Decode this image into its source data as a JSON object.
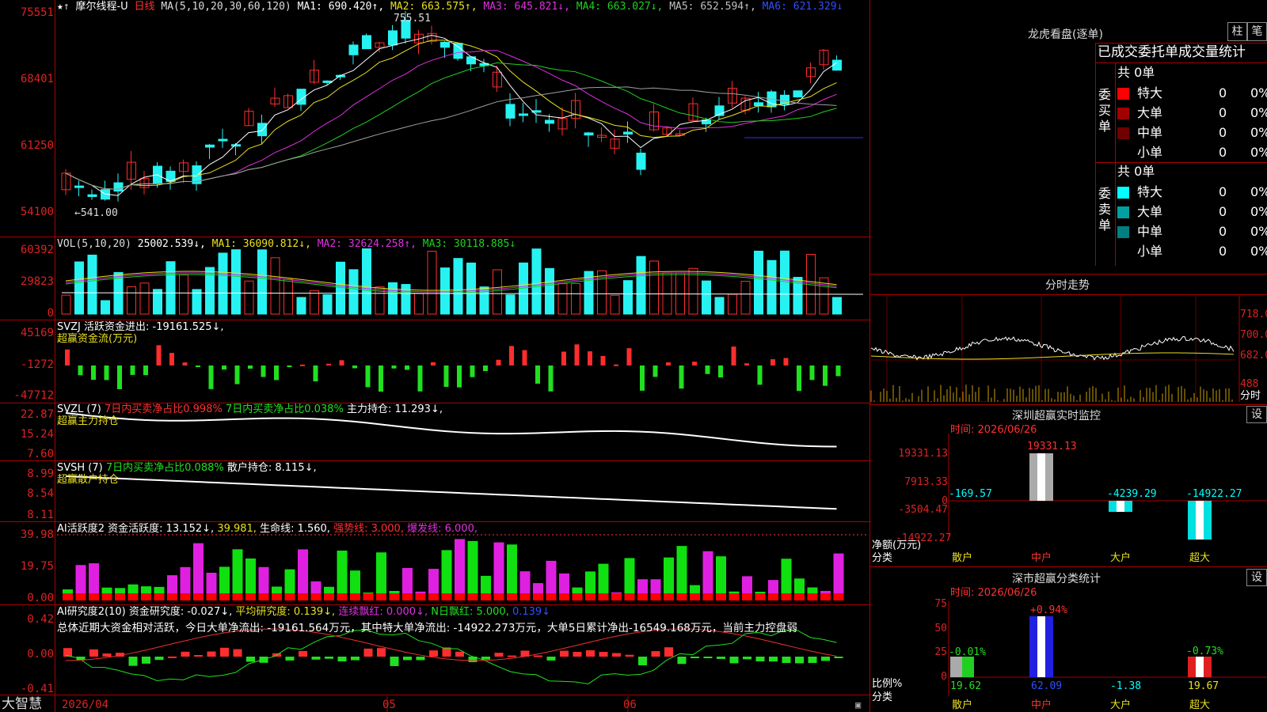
{
  "app": {
    "brand": "大智慧",
    "stock": "摩尔线程-U",
    "period": "日线"
  },
  "colors": {
    "up": "#ff2d2d",
    "down": "#27f2f2",
    "ma1": "#ffffff",
    "ma2": "#e8e020",
    "ma3": "#e030e0",
    "ma4": "#20d020",
    "ma5": "#a0a0a0",
    "ma6": "#3030ff"
  },
  "price_panel": {
    "ma_header": "MA(5,10,20,30,60,120)",
    "ma1": "MA1: 690.420↑,",
    "ma2": "MA2: 663.575↑,",
    "ma3": "MA3: 645.821↓,",
    "ma4": "MA4: 663.027↓,",
    "ma5": "MA5: 652.594↑,",
    "ma6": "MA6: 621.329↓",
    "y_ticks": [
      "75551",
      "68401",
      "61250",
      "54100"
    ],
    "high_label": "755.51",
    "low_label": "←541.00"
  },
  "vol_panel": {
    "header": "VOL(5,10,20)",
    "value": "25002.539↓,",
    "ma1": "MA1: 36090.812↓,",
    "ma2": "MA2: 32624.258↑,",
    "ma3": "MA3: 30118.885↓",
    "y_ticks": [
      "60392",
      "29823",
      "0"
    ]
  },
  "svzj_panel": {
    "header": "SVZJ  活跃资金进出: -19161.525↓,",
    "sub": "超赢资金流(万元)",
    "y_ticks": [
      "45169",
      "-1272",
      "-47712"
    ]
  },
  "svzl_panel": {
    "header": "SVZL (7)",
    "p1": "7日内买卖净占比0.998%",
    "p2": "7日内买卖净占比0.038%",
    "p3": "主力持仓: 11.293↓,",
    "sub": "超赢主力持仓",
    "y_ticks": [
      "22.87",
      "15.24",
      "7.60"
    ]
  },
  "svsh_panel": {
    "header": "SVSH (7)",
    "p1": "7日内买卖净占比0.088%",
    "p2": "散户持仓: 8.115↓,",
    "sub": "超赢散户持仓",
    "y_ticks": [
      "8.99",
      "8.54",
      "8.11"
    ]
  },
  "ai1_panel": {
    "header": "AI活跃度2",
    "p1": "资金活跃度: 13.152↓,",
    "p2": "39.981,",
    "p3": "生命线: 1.560,",
    "p4": "强势线: 3.000,",
    "p5": "爆发线: 6.000,",
    "y_ticks": [
      "39.98",
      "19.75",
      "0.00"
    ]
  },
  "ai2_panel": {
    "header": "AI研究度2(10)",
    "p1": "资金研究度: -0.027↓,",
    "p2": "平均研究度: 0.139↓,",
    "p3": "连续飘红: 0.000↓,",
    "p4": "N日飘红: 5.000,",
    "p5": "0.139↓",
    "comment": "总体近期大资金相对活跃，今日大单净流出: -19161.564万元，其中特大单净流出: -14922.273万元，大单5日累计净出-16549.168万元，当前主力控盘弱",
    "y_ticks": [
      "0.42",
      "0.00",
      "-0.41"
    ]
  },
  "x_axis": {
    "labels": [
      "2026/04",
      "05",
      "06"
    ]
  },
  "lhb": {
    "title": "龙虎看盘(逐单)",
    "btn1": "柱",
    "btn2": "笔",
    "subtitle": "已成交委托单成交量统计",
    "buy_label": "委买单",
    "sell_label": "委卖单",
    "buy": {
      "total": "共 0单",
      "rows": [
        {
          "name": "特大",
          "n": "0",
          "p": "0%",
          "color": "#ff0000"
        },
        {
          "name": "大单",
          "n": "0",
          "p": "0%",
          "color": "#a00000"
        },
        {
          "name": "中单",
          "n": "0",
          "p": "0%",
          "color": "#700000"
        },
        {
          "name": "小单",
          "n": "0",
          "p": "0%",
          "color": ""
        }
      ]
    },
    "sell": {
      "total": "共 0单",
      "rows": [
        {
          "name": "特大",
          "n": "0",
          "p": "0%",
          "color": "#00ffff"
        },
        {
          "name": "大单",
          "n": "0",
          "p": "0%",
          "color": "#00a0a0"
        },
        {
          "name": "中单",
          "n": "0",
          "p": "0%",
          "color": "#008080"
        },
        {
          "name": "小单",
          "n": "0",
          "p": "0%",
          "color": ""
        }
      ]
    }
  },
  "intraday": {
    "title": "分时走势",
    "y_ticks": [
      "718.0",
      "700.0",
      "682.0",
      "488"
    ],
    "corner": "分时"
  },
  "monitor": {
    "title": "深圳超赢实时监控",
    "btn": "设",
    "time": "时间: 2026/06/26",
    "y_ticks": [
      "19331.13",
      "7913.33",
      "0",
      "-3504.47",
      "-14922.27"
    ],
    "bar_labels": [
      "-169.57",
      "19331.13",
      "-4239.29",
      "-14922.27"
    ],
    "cats": [
      "散户",
      "中户",
      "大户",
      "超大"
    ],
    "axis_label1": "净额(万元)",
    "axis_label2": "分类"
  },
  "classify": {
    "title": "深市超赢分类统计",
    "btn": "设",
    "time": "时间: 2026/06/26",
    "y_ticks": [
      "75",
      "50",
      "25",
      "0"
    ],
    "top_labels": [
      "-0.01%",
      "+0.94%",
      "",
      "-0.73%"
    ],
    "bottom_values": [
      "19.62",
      "62.09",
      "-1.38",
      "19.67"
    ],
    "cats": [
      "散户",
      "中户",
      "大户",
      "超大"
    ],
    "axis_label1": "比例%",
    "axis_label2": "分类"
  }
}
